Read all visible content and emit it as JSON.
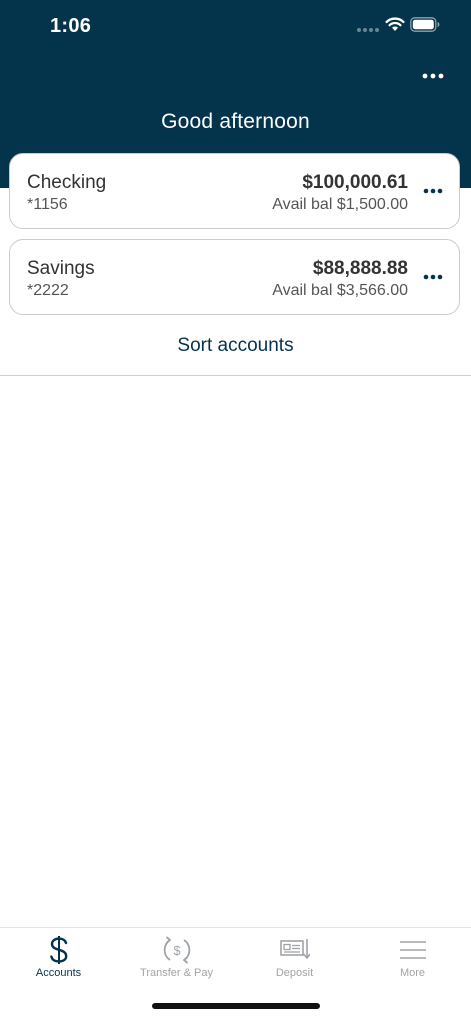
{
  "status_bar": {
    "time": "1:06"
  },
  "header": {
    "greeting": "Good afternoon",
    "menu_icon": "more-horizontal-icon",
    "background_color": "#04344c"
  },
  "accounts": [
    {
      "name": "Checking",
      "number": "*1156",
      "balance": "$100,000.61",
      "available": "Avail bal $1,500.00"
    },
    {
      "name": "Savings",
      "number": "*2222",
      "balance": "$88,888.88",
      "available": "Avail bal $3,566.00"
    }
  ],
  "sort_accounts_label": "Sort accounts",
  "tab_bar": {
    "active_color": "#04344c",
    "inactive_color": "#a0a4a8",
    "tabs": [
      {
        "label": "Accounts",
        "icon": "dollar-icon",
        "active": true
      },
      {
        "label": "Transfer & Pay",
        "icon": "transfer-pay-icon",
        "active": false
      },
      {
        "label": "Deposit",
        "icon": "check-deposit-icon",
        "active": false
      },
      {
        "label": "More",
        "icon": "hamburger-menu-icon",
        "active": false
      }
    ]
  }
}
